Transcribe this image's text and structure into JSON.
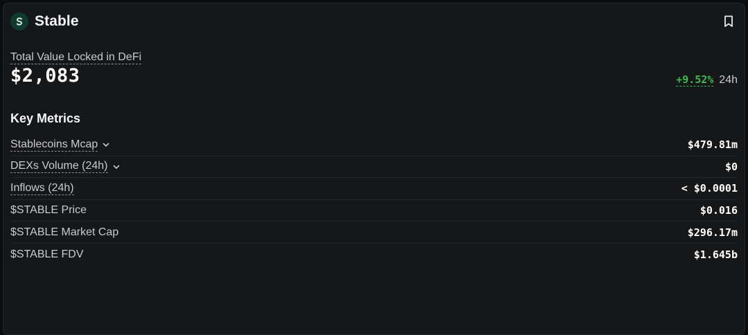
{
  "protocol": {
    "name": "Stable",
    "logo_icon": "stable-logo-icon",
    "bookmark_icon": "bookmark-icon"
  },
  "tvl": {
    "label": "Total Value Locked in DeFi",
    "value": "$2,083",
    "change_pct": "+9.52%",
    "change_period": "24h",
    "change_color": "#3fb950"
  },
  "key_metrics": {
    "title": "Key Metrics",
    "rows": [
      {
        "label": "Stablecoins Mcap",
        "value": "$479.81m",
        "expandable": true
      },
      {
        "label": "DEXs Volume (24h)",
        "value": "$0",
        "expandable": true
      },
      {
        "label": "Inflows (24h)",
        "value": "< $0.0001",
        "expandable": false
      },
      {
        "label": "$STABLE Price",
        "value": "$0.016",
        "expandable": false
      },
      {
        "label": "$STABLE Market Cap",
        "value": "$296.17m",
        "expandable": false
      },
      {
        "label": "$STABLE FDV",
        "value": "$1.645b",
        "expandable": false
      }
    ]
  },
  "colors": {
    "background": "#161719",
    "accent_green": "#3fb950"
  }
}
